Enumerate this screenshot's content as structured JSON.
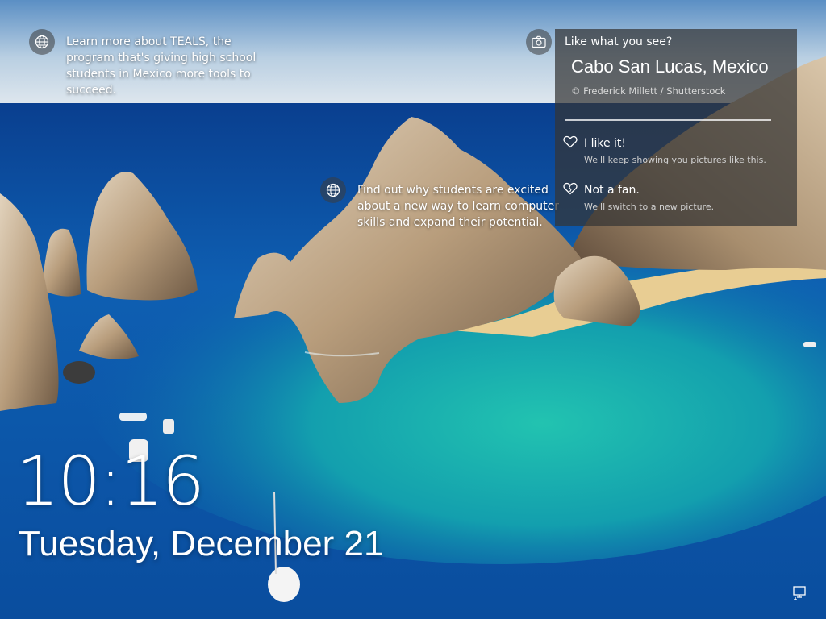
{
  "hotspots": {
    "teals": {
      "text": "Learn more about TEALS, the program that's giving high school students in Mexico more tools to succeed.",
      "icon": "globe-icon"
    },
    "students": {
      "text": "Find out why students are excited about a new way to learn computer skills and expand their potential.",
      "icon": "globe-icon"
    }
  },
  "like_panel": {
    "camera_icon": "camera-icon",
    "heading": "Like what you see?",
    "location": "Cabo San Lucas, Mexico",
    "credit": "© Frederick Millett / Shutterstock",
    "like": {
      "icon": "heart-icon",
      "label": "I like it!",
      "sub": "We'll keep showing you pictures like this."
    },
    "not_fan": {
      "icon": "heart-icon",
      "label": "Not a fan.",
      "sub": "We'll switch to a new picture."
    }
  },
  "clock": {
    "time": "10:16",
    "date": "Tuesday, December 21"
  },
  "system": {
    "network_icon": "network-icon"
  },
  "colors": {
    "sea_deep": "#0b4fa0",
    "sea_turquoise": "#1ab3a6",
    "sky": "#a9c4dc",
    "rock": "#c7b49a",
    "sand": "#e6c98c"
  }
}
